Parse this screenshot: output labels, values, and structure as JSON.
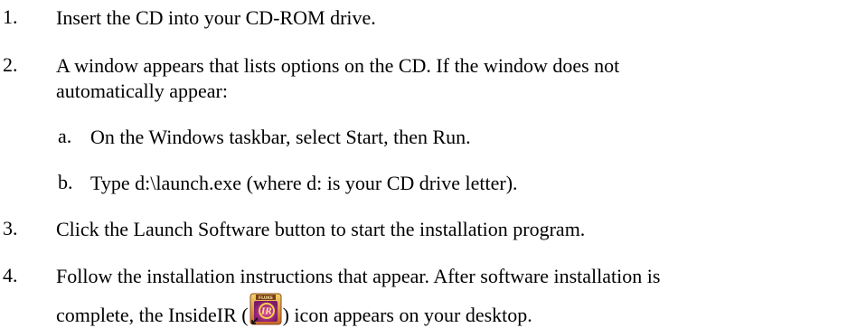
{
  "steps": [
    {
      "number": "1.",
      "text": "Insert the CD into your CD-ROM drive."
    },
    {
      "number": "2.",
      "line1": "A window appears that lists options on the CD. If the window does not",
      "line2": "automatically appear:",
      "substeps": [
        {
          "letter": "a.",
          "text": "On the Windows taskbar, select Start, then Run."
        },
        {
          "letter": "b.",
          "text": "Type d:\\launch.exe (where d: is your CD drive letter)."
        }
      ]
    },
    {
      "number": "3.",
      "text": "Click the Launch Software button to start the installation program."
    },
    {
      "number": "4.",
      "line1": "Follow the installation instructions that appear. After software installation is",
      "line2_before_icon": "complete, the InsideIR (",
      "line2_after_icon": ") icon appears on your desktop.",
      "icon": {
        "name": "insideir-icon",
        "label": "FLUKE",
        "inner_text": "IR",
        "colors": {
          "frame_top": "#e9c75a",
          "frame_bottom": "#c9652a",
          "inner": "#c92c8a",
          "ring": "#f3d24a"
        }
      }
    }
  ]
}
